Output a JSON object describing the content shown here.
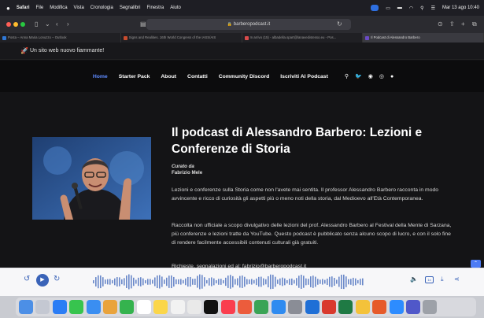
{
  "menubar": {
    "apple": "",
    "app": "Safari",
    "menus": [
      "File",
      "Modifica",
      "Vista",
      "Cronologia",
      "Segnalibri",
      "Finestra",
      "Aiuto"
    ],
    "clock": "Mar 13 ago 10:40"
  },
  "browser": {
    "url": "barberopodcast.it",
    "tabs": [
      {
        "label": "Posta – Anna Maria Lonuzzo – Outlook",
        "color": "#2f78d6"
      },
      {
        "label": "Signs and Realities. 16th World Congress of the IASS/AIS",
        "color": "#c94c2e"
      },
      {
        "label": "In arrivo (15) - albadella.spart@lanavedistesso.eu - Pos...",
        "color": "#d94b4b"
      },
      {
        "label": "Il Podcast di Alessandro Barbero",
        "color": "#6b4bc5"
      }
    ]
  },
  "site": {
    "notice": "Un sito web nuovo fiammante!",
    "nav": [
      "Home",
      "Starter Pack",
      "About",
      "Contatti",
      "Community Discord",
      "Iscriviti Al Podcast"
    ],
    "title": "Il podcast di Alessandro Barbero: Lezioni e Conferenze di Storia",
    "curated_label": "Curato da",
    "curator": "Fabrizio Mele",
    "paragraphs": [
      "Lezioni e conferenze sulla Storia come non l'avete mai sentita. Il professor Alessandro Barbero racconta in modo avvincente e ricco di curiosità gli aspetti più o meno noti della storia, dal Medioevo all'Età Contemporanea.",
      "Raccolta non ufficiale a scopo divulgativo delle lezioni del prof. Alessandro Barbero al Festival della Mente di Sarzana, più conferenze e lezioni tratte da YouTube. Questo podcast è pubblicato senza alcuno scopo di lucro, e con il solo fine di rendere facilmente accessibili contenuti culturali già gratuiti.",
      "Richieste, segnalazioni ed al: fabrizio@barberopodcast.it"
    ]
  },
  "player": {
    "rewind_label": "15",
    "forward_label": "30",
    "speed_label": "1x"
  },
  "icons": {
    "search": "search-icon",
    "social": [
      "twitter-icon",
      "discord-icon",
      "instagram-icon",
      "facebook-icon"
    ]
  },
  "colors": {
    "accent": "#5e8bff",
    "player_accent": "#3a63b8",
    "page_bg": "#141416"
  }
}
